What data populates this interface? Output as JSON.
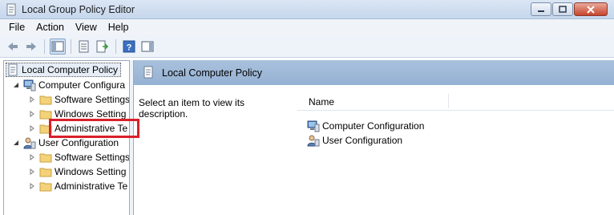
{
  "window": {
    "title": "Local Group Policy Editor"
  },
  "menu": [
    "File",
    "Action",
    "View",
    "Help"
  ],
  "tree": {
    "root": "Local Computer Policy",
    "computer": {
      "label": "Computer Configura",
      "children": [
        "Software Settings",
        "Windows Setting",
        "Administrative Te"
      ]
    },
    "user": {
      "label": "User Configuration",
      "children": [
        "Software Settings",
        "Windows Setting",
        "Administrative Te"
      ]
    }
  },
  "right": {
    "header_title": "Local Computer Policy",
    "description": "Select an item to view its description.",
    "column_name": "Name",
    "items": [
      "Computer Configuration",
      "User Configuration"
    ]
  },
  "colors": {
    "highlight": "#d9202a",
    "header": "#a9c1dd"
  }
}
